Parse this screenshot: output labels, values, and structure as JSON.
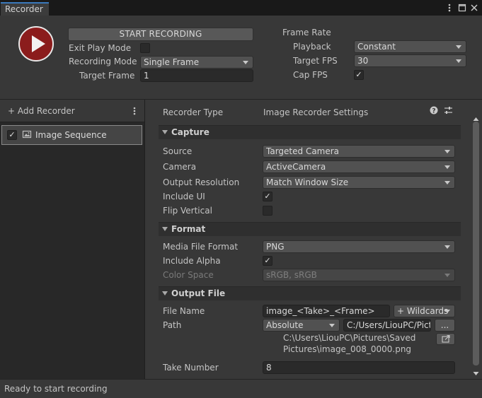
{
  "window": {
    "tab_title": "Recorder",
    "icons": [
      "kebab-menu-icon",
      "maximize-icon",
      "close-icon"
    ]
  },
  "top": {
    "start_recording_label": "START RECORDING",
    "exit_play_mode_label": "Exit Play Mode",
    "exit_play_mode_checked": false,
    "recording_mode_label": "Recording Mode",
    "recording_mode_value": "Single Frame",
    "target_frame_label": "Target Frame",
    "target_frame_value": "1",
    "frame_rate_label": "Frame Rate",
    "playback_label": "Playback",
    "playback_value": "Constant",
    "target_fps_label": "Target FPS",
    "target_fps_value": "30",
    "cap_fps_label": "Cap FPS",
    "cap_fps_checked": true
  },
  "recorder_list": {
    "add_recorder_label": "+ Add Recorder",
    "items": [
      {
        "label": "Image Sequence",
        "enabled": true
      }
    ]
  },
  "inspector": {
    "recorder_type_label": "Recorder Type",
    "recorder_type_value": "Image Recorder Settings",
    "capture": {
      "header": "Capture",
      "source_label": "Source",
      "source_value": "Targeted Camera",
      "camera_label": "Camera",
      "camera_value": "ActiveCamera",
      "output_resolution_label": "Output Resolution",
      "output_resolution_value": "Match Window Size",
      "include_ui_label": "Include UI",
      "include_ui_checked": true,
      "flip_vertical_label": "Flip Vertical",
      "flip_vertical_checked": false
    },
    "format": {
      "header": "Format",
      "media_file_format_label": "Media File Format",
      "media_file_format_value": "PNG",
      "include_alpha_label": "Include Alpha",
      "include_alpha_checked": true,
      "color_space_label": "Color Space",
      "color_space_value": "sRGB, sRGB"
    },
    "output_file": {
      "header": "Output File",
      "file_name_label": "File Name",
      "file_name_value": "image_<Take>_<Frame>",
      "wildcards_label": "+ Wildcards",
      "path_label": "Path",
      "path_mode_value": "Absolute",
      "path_value": "C:/Users/LiouPC/Pictures/Saved Pictures",
      "browse_label": "...",
      "resolved_path_line1": "C:\\Users\\LiouPC\\Pictures\\Saved",
      "resolved_path_line2": "Pictures\\image_008_0000.png",
      "take_number_label": "Take Number",
      "take_number_value": "8"
    }
  },
  "status": {
    "text": "Ready to start recording"
  },
  "colors": {
    "record_button": "#8b1c1c",
    "tab_accent": "#3a79bb",
    "background": "#383838"
  }
}
